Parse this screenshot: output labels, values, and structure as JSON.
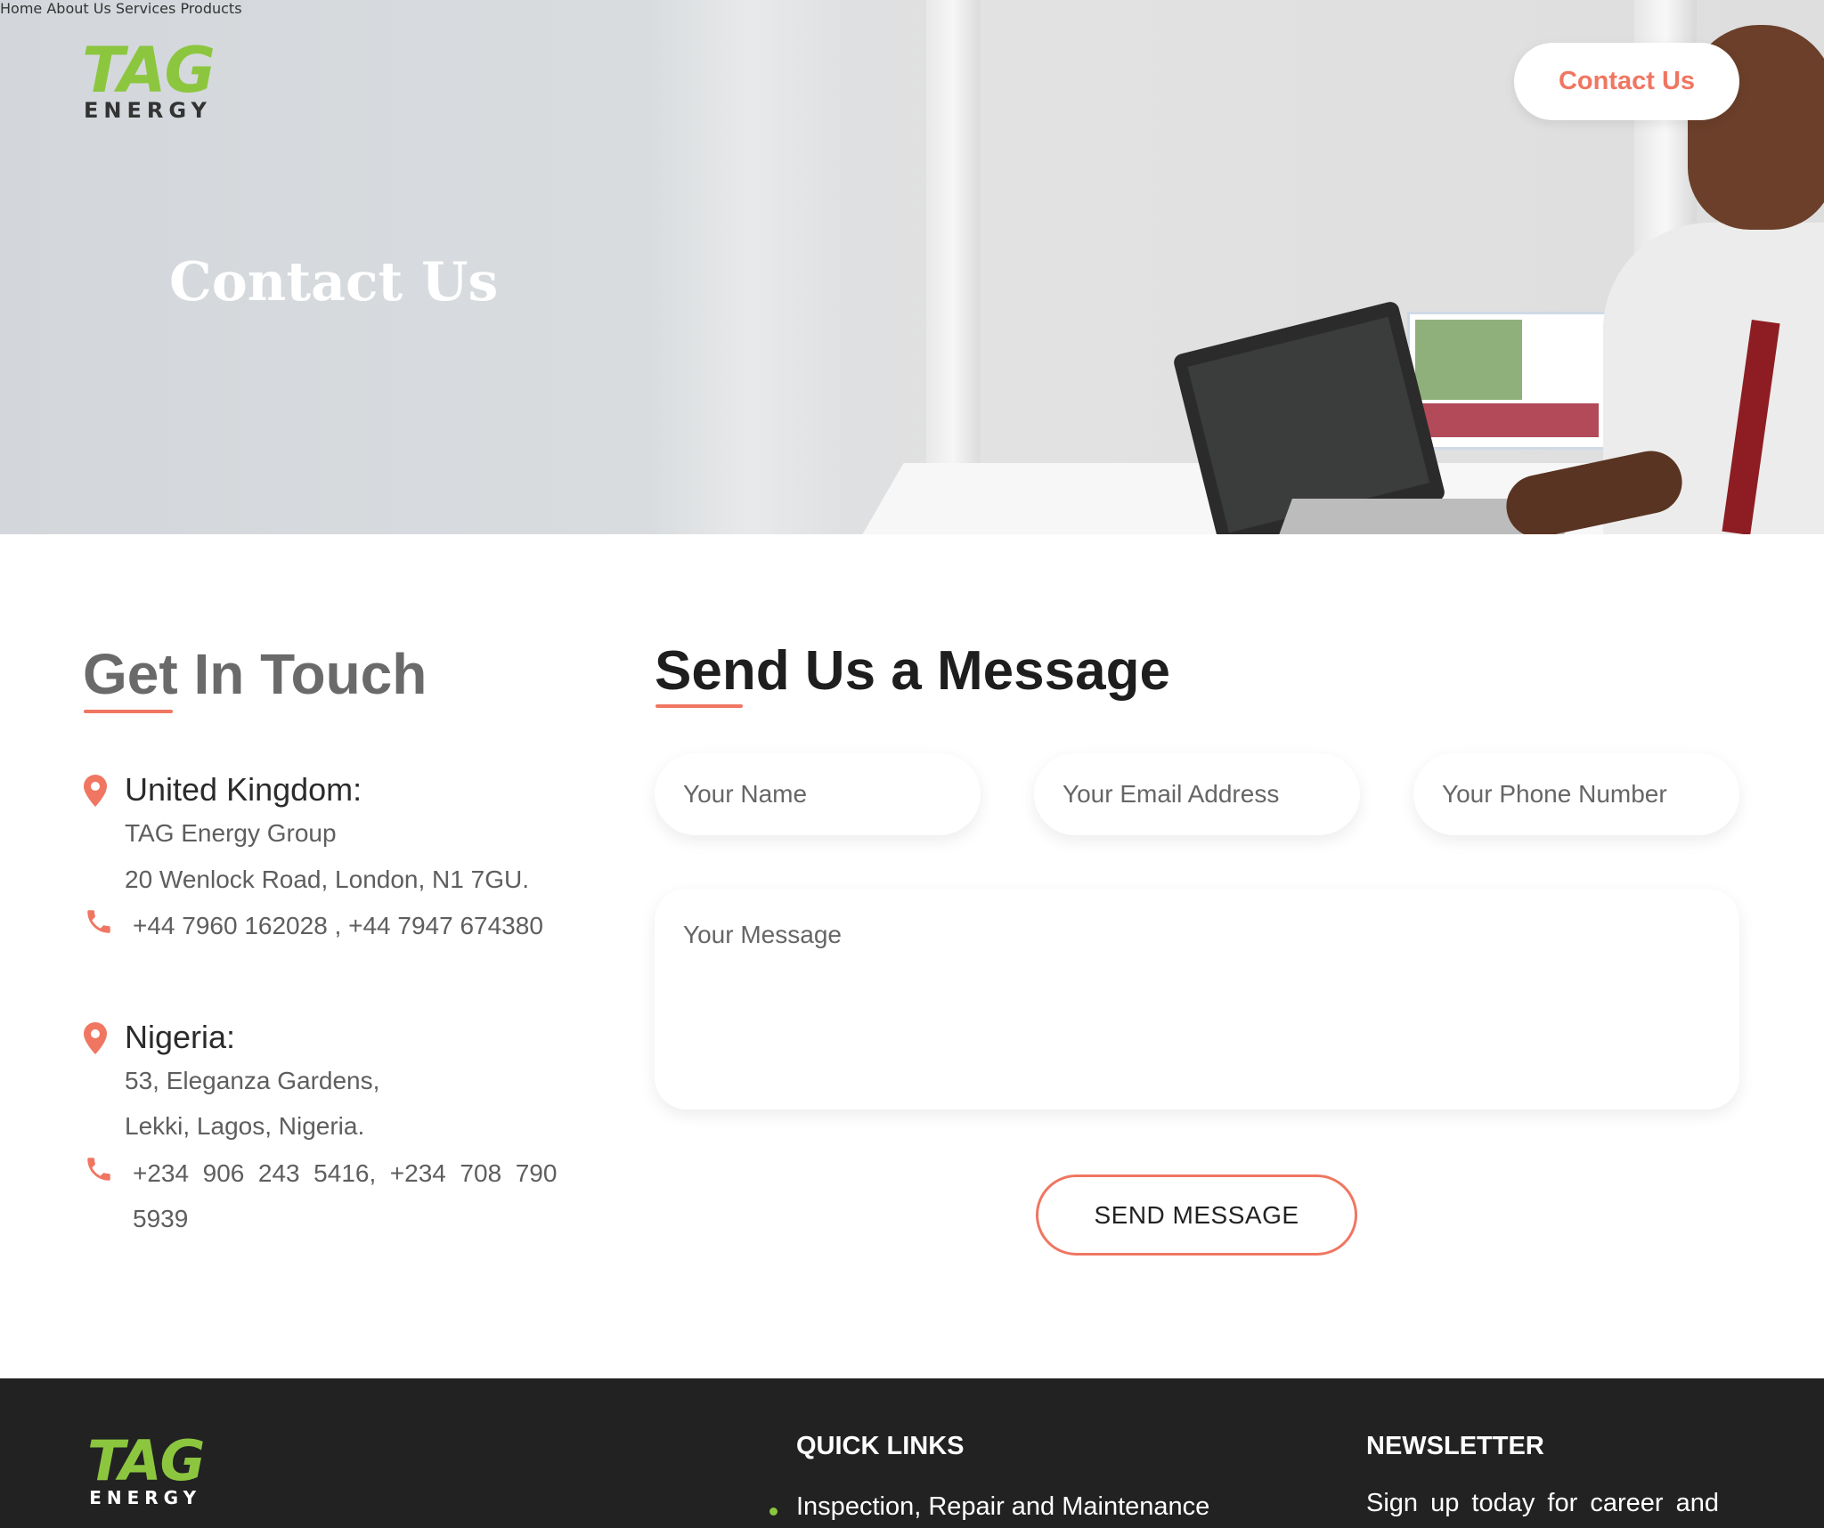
{
  "brand": {
    "logo_main": "TAG",
    "logo_sub": "ENERGY",
    "accent_color": "#f07662",
    "logo_color": "#8cc63f"
  },
  "nav": {
    "items": [
      "Home",
      "About Us",
      "Services",
      "Products"
    ],
    "cta": "Contact Us"
  },
  "hero": {
    "title": "Contact Us"
  },
  "get_in_touch": {
    "heading": "Get In Touch",
    "uk": {
      "title": "United Kingdom:",
      "line1": "TAG Energy Group",
      "line2": "20 Wenlock Road, London, N1 7GU.",
      "phone": "+44 7960 162028 , +44 7947 674380"
    },
    "nigeria": {
      "title": "Nigeria:",
      "line1": "53, Eleganza Gardens,",
      "line2": "Lekki, Lagos, Nigeria.",
      "phone_line1": "+234  906  243  5416,  +234  708  790",
      "phone_line2": "5939"
    }
  },
  "message_form": {
    "heading": "Send Us a Message",
    "name_placeholder": "Your Name",
    "email_placeholder": "Your Email Address",
    "phone_placeholder": "Your Phone Number",
    "message_placeholder": "Your Message",
    "submit_label": "SEND MESSAGE"
  },
  "footer": {
    "quick_links_heading": "QUICK LINKS",
    "quick_links": [
      "Inspection, Repair and Maintenance"
    ],
    "newsletter_heading": "NEWSLETTER",
    "newsletter_text": "Sign up today for career and"
  }
}
